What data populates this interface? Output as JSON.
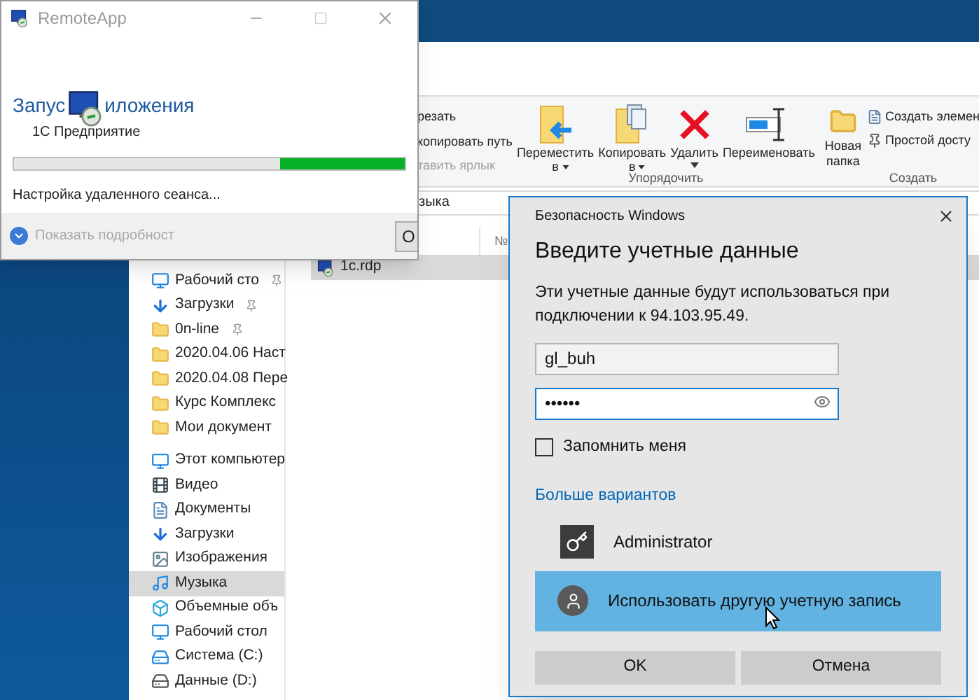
{
  "remote_app": {
    "title": "RemoteApp",
    "heading_start": "Запус",
    "heading_end": "иложения",
    "app_name": "1C Предприятие",
    "progress": {
      "level": 0.32
    },
    "status": "Настройка удаленного сеанса...",
    "details_toggle": "Показать подробност",
    "button": "О"
  },
  "explorer": {
    "ribbon": {
      "clipboard": [
        {
          "label": "резать",
          "disabled": false
        },
        {
          "label": "копировать путь",
          "disabled": false
        },
        {
          "label": "тавить ярлык",
          "disabled": true
        }
      ],
      "organize": {
        "label": "Упорядочить",
        "buttons": [
          {
            "kind": "move",
            "lines": [
              "Переместить",
              "в"
            ],
            "dropdown": true
          },
          {
            "kind": "copy",
            "lines": [
              "Копировать",
              "в"
            ],
            "dropdown": true
          },
          {
            "kind": "delete",
            "lines": [
              "Удалить"
            ],
            "dropdown": true
          },
          {
            "kind": "rename",
            "lines": [
              "Переименовать"
            ],
            "dropdown": false
          }
        ]
      },
      "create": {
        "label": "Создать",
        "new_folder": [
          "Новая",
          "папка"
        ],
        "items": [
          {
            "kind": "new_item",
            "label": "Создать элемен"
          },
          {
            "kind": "easy_access",
            "label": "Простой досту"
          }
        ]
      }
    },
    "address": "зыка",
    "columns": [
      "№"
    ],
    "nav": [
      {
        "kind": "desktop",
        "label": "Рабочий сто",
        "pinned": true,
        "selected": false
      },
      {
        "kind": "downloads",
        "label": "Загрузки",
        "pinned": true,
        "selected": false
      },
      {
        "kind": "folder",
        "label": "0n-line",
        "pinned": true,
        "selected": false
      },
      {
        "kind": "folder",
        "label": "2020.04.06 Наст",
        "pinned": false,
        "selected": false
      },
      {
        "kind": "folder",
        "label": "2020.04.08 Пере",
        "pinned": false,
        "selected": false
      },
      {
        "kind": "folder",
        "label": "Курс Комплекс",
        "pinned": false,
        "selected": false
      },
      {
        "kind": "folder",
        "label": "Мои документ",
        "pinned": false,
        "selected": false
      },
      {
        "kind": "computer",
        "label": "Этот компьютер",
        "pinned": false,
        "selected": false
      },
      {
        "kind": "video",
        "label": "Видео",
        "pinned": false,
        "selected": false
      },
      {
        "kind": "documents",
        "label": "Документы",
        "pinned": false,
        "selected": false
      },
      {
        "kind": "downloads",
        "label": "Загрузки",
        "pinned": false,
        "selected": false
      },
      {
        "kind": "pictures",
        "label": "Изображения",
        "pinned": false,
        "selected": false
      },
      {
        "kind": "music",
        "label": "Музыка",
        "pinned": false,
        "selected": true
      },
      {
        "kind": "objects",
        "label": "Объемные объ",
        "pinned": false,
        "selected": false
      },
      {
        "kind": "desktop",
        "label": "Рабочий стол",
        "pinned": false,
        "selected": false
      },
      {
        "kind": "system_drive",
        "label": "Система (C:)",
        "pinned": false,
        "selected": false
      },
      {
        "kind": "drive",
        "label": "Данные (D:)",
        "pinned": false,
        "selected": false
      }
    ],
    "files": [
      {
        "name": "1c.rdp",
        "selected": true
      }
    ]
  },
  "dialog": {
    "window_title": "Безопасность Windows",
    "heading": "Введите учетные данные",
    "description": "Эти учетные данные будут использоваться при подключении к 94.103.95.49.",
    "fields": [
      {
        "kind": "text",
        "value": "gl_buh",
        "focused": false
      },
      {
        "kind": "password",
        "value": "••••••",
        "focused": true
      }
    ],
    "remember": {
      "label": "Запомнить меня",
      "checked": false
    },
    "more_options": "Больше вариантов",
    "accounts": [
      {
        "kind": "key",
        "name": "Administrator",
        "selected": false
      },
      {
        "kind": "person",
        "name": "Использовать другую учетную запись",
        "selected": true
      }
    ],
    "buttons": [
      "OK",
      "Отмена"
    ]
  }
}
